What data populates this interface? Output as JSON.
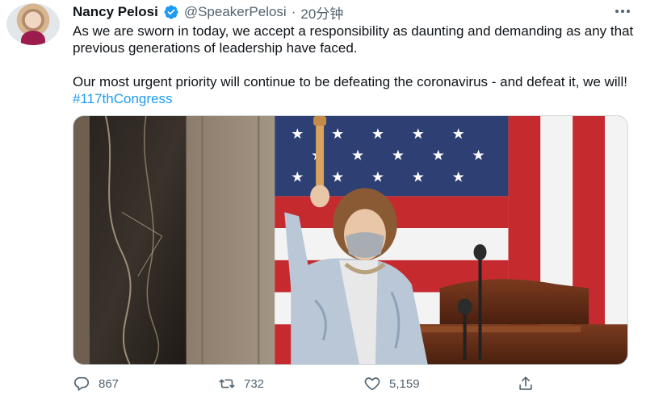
{
  "tweet": {
    "author_name": "Nancy Pelosi",
    "handle": "@SpeakerPelosi",
    "separator": "·",
    "time": "20分钟",
    "text_paragraph_1": "As we are sworn in today, we accept a responsibility as daunting and demanding as any that previous generations of leadership have faced.",
    "text_paragraph_2": "Our most urgent priority will continue to be defeating the coronavirus - and defeat it, we will! ",
    "hashtag": "#117thCongress"
  },
  "actions": {
    "replies": "867",
    "retweets": "732",
    "likes": "5,159"
  },
  "icons": {
    "verified": "verified-badge-icon",
    "more": "more-options-icon",
    "reply": "reply-icon",
    "retweet": "retweet-icon",
    "like": "heart-icon",
    "share": "share-icon"
  },
  "colors": {
    "accent": "#1d9bf0",
    "secondary_text": "#536471"
  }
}
